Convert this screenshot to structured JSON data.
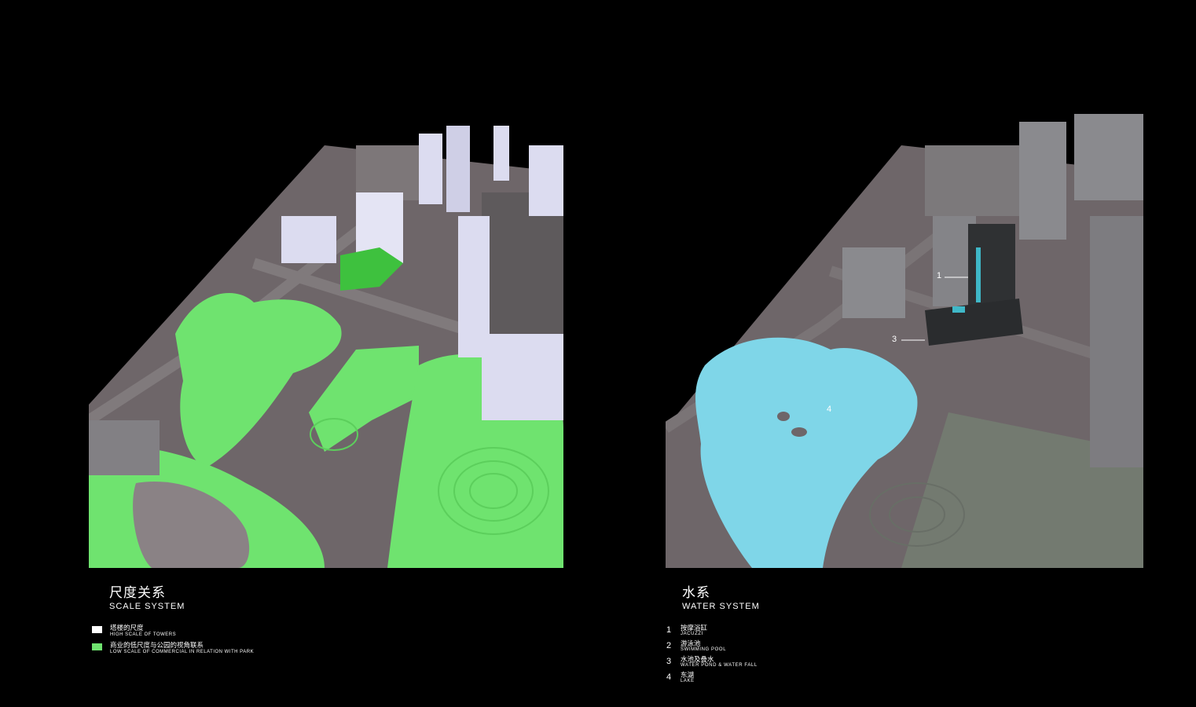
{
  "scale_system": {
    "title_cn": "尺度关系",
    "title_en": "SCALE SYSTEM",
    "legend": [
      {
        "cn": "塔楼的尺度",
        "en": "HIGH SCALE OF TOWERS",
        "color": "#ffffff"
      },
      {
        "cn": "商业的低尺度与公园的视角联系",
        "en": "LOW SCALE OF COMMERCIAL IN RELATION WITH PARK",
        "color": "#6fe36f"
      }
    ]
  },
  "water_system": {
    "title_cn": "水系",
    "title_en": "WATER SYSTEM",
    "items": [
      {
        "num": "1",
        "cn": "按摩浴缸",
        "en": "JACUZZI"
      },
      {
        "num": "2",
        "cn": "游泳池",
        "en": "SWIMMING POOL"
      },
      {
        "num": "3",
        "cn": "水池及叠水",
        "en": "WATER POND & WATER FALL"
      },
      {
        "num": "4",
        "cn": "东湖",
        "en": "LAKE"
      }
    ],
    "markers": [
      "1",
      "3",
      "4"
    ]
  },
  "colors": {
    "background": "#000000",
    "ground": "#6e6669",
    "park_green": "#6fe36f",
    "tower_white": "#dcdcf0",
    "water_blue": "#7fd6e8",
    "building_grey": "#8a8a8e"
  }
}
